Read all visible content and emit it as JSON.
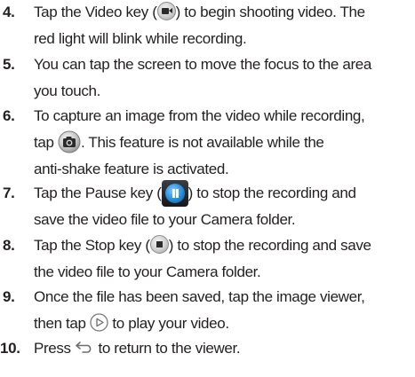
{
  "steps": [
    {
      "number": "4.",
      "lines": [
        {
          "before": "Tap the Video key (",
          "icon": "video-key-icon",
          "after": ") to begin shooting video. The"
        },
        {
          "text": "red light will blink while recording."
        }
      ]
    },
    {
      "number": "5.",
      "lines": [
        {
          "text": "You can tap the screen to move the focus to the area"
        },
        {
          "text": "you touch."
        }
      ]
    },
    {
      "number": "6.",
      "lines": [
        {
          "text": "To capture an image from the video while recording,"
        },
        {
          "before": "tap ",
          "icon": "camera-icon",
          "after": ". This feature is not available while the"
        },
        {
          "text": "anti-shake feature is activated."
        }
      ]
    },
    {
      "number": "7.",
      "lines": [
        {
          "before": "Tap the Pause key (",
          "icon": "pause-key-icon",
          "after": ") to stop the recording and"
        },
        {
          "text": "save the video file to your Camera folder."
        }
      ]
    },
    {
      "number": "8.",
      "lines": [
        {
          "before": "Tap the Stop key (",
          "icon": "stop-key-icon",
          "after": ") to stop the recording and save"
        },
        {
          "text": "the video file to your Camera folder."
        }
      ]
    },
    {
      "number": "9.",
      "lines": [
        {
          "text": "Once the file has been saved, tap the image viewer,"
        },
        {
          "before": "then tap ",
          "icon": "play-icon",
          "after": " to play your video."
        }
      ]
    },
    {
      "number": "10.",
      "lines": [
        {
          "before": "Press ",
          "icon": "back-arrow-icon",
          "after": " to return to the viewer."
        }
      ]
    }
  ]
}
